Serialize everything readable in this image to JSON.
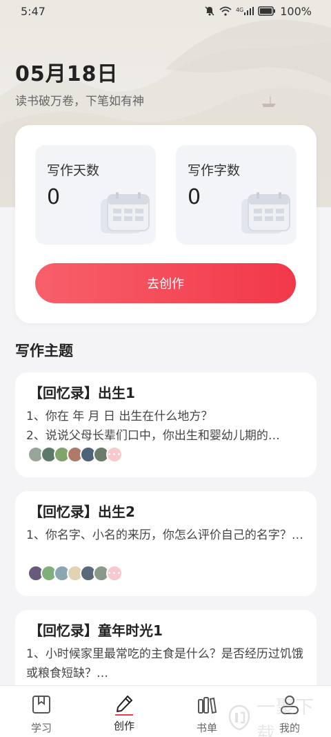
{
  "status": {
    "time": "5:47",
    "network": "4G",
    "battery": "100%"
  },
  "header": {
    "date": "05月18日",
    "motto": "读书破万卷，下笔如有神"
  },
  "stats": {
    "days_label": "写作天数",
    "days_value": "0",
    "words_label": "写作字数",
    "words_value": "0",
    "create_button": "去创作"
  },
  "topics": {
    "section_title": "写作主题",
    "items": [
      {
        "title": "【回忆录】出生1",
        "desc": "1、你在 年 月 日 出生在什么地方？\n2、说说父母长辈们口中，你出生和婴幼儿期的…"
      },
      {
        "title": "【回忆录】出生2",
        "desc": "1、你名字、小名的来历，你怎么评价自己的名字？…"
      },
      {
        "title": "【回忆录】童年时光1",
        "desc": "1、小时候家里最常吃的主食是什么？是否经历过饥饿或粮食短缺？…"
      }
    ]
  },
  "nav": {
    "items": [
      {
        "label": "学习",
        "icon": "bookmark-icon"
      },
      {
        "label": "创作",
        "icon": "pen-icon"
      },
      {
        "label": "书单",
        "icon": "bookshelf-icon"
      },
      {
        "label": "我的",
        "icon": "user-icon"
      }
    ],
    "active_index": 1
  },
  "watermark": {
    "text": "一聚下载"
  },
  "colors": {
    "accent": "#ef3d4d",
    "background": "#f4f4f6"
  }
}
